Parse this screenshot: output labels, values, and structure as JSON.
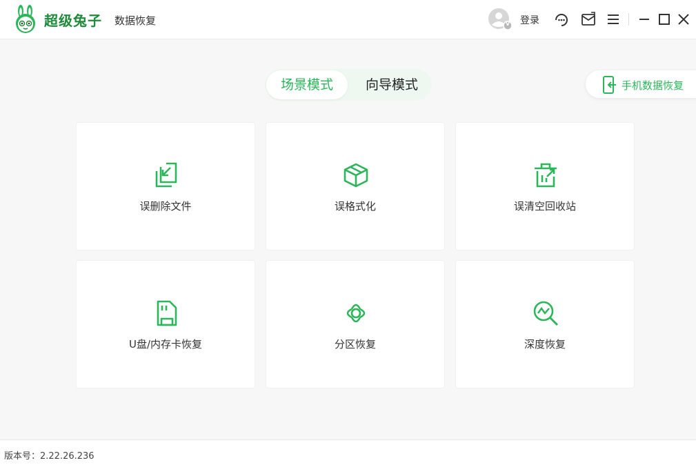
{
  "app": {
    "brand": "超级兔子",
    "subtitle": "数据恢复"
  },
  "header": {
    "login_label": "登录",
    "avatar_badge": "V"
  },
  "modes": [
    {
      "label": "场景模式",
      "active": true
    },
    {
      "label": "向导模式",
      "active": false
    }
  ],
  "phone_recovery_label": "手机数据恢复",
  "cards": [
    {
      "label": "误删除文件",
      "icon": "file-restore-icon"
    },
    {
      "label": "误格式化",
      "icon": "box-icon"
    },
    {
      "label": "误清空回收站",
      "icon": "recycle-bin-icon"
    },
    {
      "label": "U盘/内存卡恢复",
      "icon": "sd-card-icon"
    },
    {
      "label": "分区恢复",
      "icon": "partition-icon"
    },
    {
      "label": "深度恢复",
      "icon": "deep-scan-icon"
    }
  ],
  "footer": {
    "version_text": "版本号：2.22.26.236"
  },
  "colors": {
    "accent": "#2bb65a",
    "brand": "#1f8a3a",
    "background": "#f7f7f7"
  }
}
